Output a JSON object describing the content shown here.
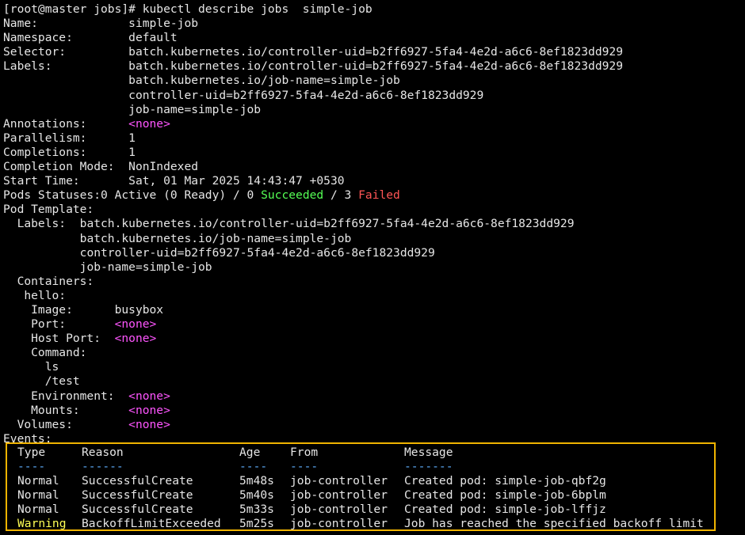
{
  "prompt": "[root@master jobs]# kubectl describe jobs  simple-job",
  "fields": [
    {
      "k": "Name:",
      "v": "simple-job"
    },
    {
      "k": "Namespace:",
      "v": "default"
    },
    {
      "k": "Selector:",
      "v": "batch.kubernetes.io/controller-uid=b2ff6927-5fa4-4e2d-a6c6-8ef1823dd929"
    },
    {
      "k": "Labels:",
      "v": "batch.kubernetes.io/controller-uid=b2ff6927-5fa4-4e2d-a6c6-8ef1823dd929"
    },
    {
      "k": "",
      "v": "batch.kubernetes.io/job-name=simple-job"
    },
    {
      "k": "",
      "v": "controller-uid=b2ff6927-5fa4-4e2d-a6c6-8ef1823dd929"
    },
    {
      "k": "",
      "v": "job-name=simple-job"
    },
    {
      "k": "Annotations:",
      "v": "<none>"
    },
    {
      "k": "Parallelism:",
      "v": "1"
    },
    {
      "k": "Completions:",
      "v": "1"
    },
    {
      "k": "Completion Mode:",
      "v": "NonIndexed"
    },
    {
      "k": "Start Time:",
      "v": "Sat, 01 Mar 2025 14:43:47 +0530"
    }
  ],
  "pods_statuses": {
    "key": "Pods Statuses:",
    "part1": "0 Active (0 Ready) / 0 ",
    "succeeded": "Succeeded",
    "part2": " / 3 ",
    "failed": "Failed"
  },
  "pod_template": {
    "key": "Pod Template:",
    "labels_key": "Labels:",
    "labels": [
      "batch.kubernetes.io/controller-uid=b2ff6927-5fa4-4e2d-a6c6-8ef1823dd929",
      "batch.kubernetes.io/job-name=simple-job",
      "controller-uid=b2ff6927-5fa4-4e2d-a6c6-8ef1823dd929",
      "job-name=simple-job"
    ],
    "containers_key": "Containers:",
    "container_name": "hello:",
    "image_key": "Image:",
    "image": "busybox",
    "port_key": "Port:",
    "host_port_key": "Host Port:",
    "command_key": "Command:",
    "command": [
      "ls",
      "/test"
    ],
    "env_key": "Environment:",
    "mounts_key": "Mounts:",
    "volumes_key": "Volumes:",
    "none": "<none>"
  },
  "events": {
    "key": "Events:",
    "headers": [
      "Type",
      "Reason",
      "Age",
      "From",
      "Message"
    ],
    "dashes": [
      "----",
      "------",
      "----",
      "----",
      "-------"
    ],
    "rows": [
      {
        "type": "Normal",
        "reason": "SuccessfulCreate",
        "age": "5m48s",
        "from": "job-controller",
        "message": "Created pod: simple-job-qbf2g"
      },
      {
        "type": "Normal",
        "reason": "SuccessfulCreate",
        "age": "5m40s",
        "from": "job-controller",
        "message": "Created pod: simple-job-6bplm"
      },
      {
        "type": "Normal",
        "reason": "SuccessfulCreate",
        "age": "5m33s",
        "from": "job-controller",
        "message": "Created pod: simple-job-lffjz"
      },
      {
        "type": "Warning",
        "reason": "BackoffLimitExceeded",
        "age": "5m25s",
        "from": "job-controller",
        "message": "Job has reached the specified backoff limit"
      }
    ]
  },
  "colors": {
    "none": "#ff55ff",
    "succeeded": "#55ff55",
    "failed": "#ff5555",
    "warning": "#ffff55",
    "highlight": "#f0b400"
  }
}
